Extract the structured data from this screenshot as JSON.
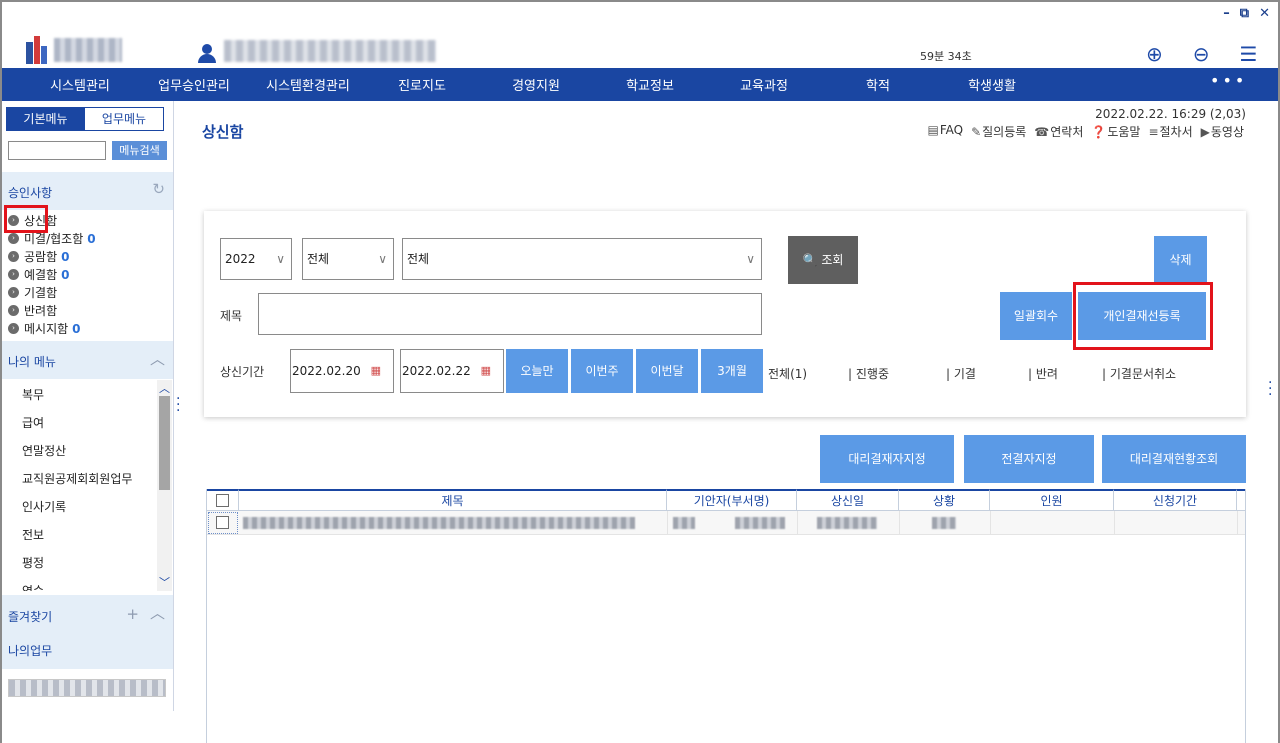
{
  "window": {
    "minimize": "–",
    "restore": "⧉",
    "close": "✕"
  },
  "header": {
    "timer": "59분 34초",
    "icons": [
      "zoom-in-icon",
      "zoom-out-icon",
      "menu-icon"
    ]
  },
  "nav": {
    "items": [
      "시스템관리",
      "업무승인관리",
      "시스템환경관리",
      "진로지도",
      "경영지원",
      "학교정보",
      "교육과정",
      "학적",
      "학생생활"
    ],
    "more": "•••"
  },
  "sidebar": {
    "tabs": [
      "기본메뉴",
      "업무메뉴"
    ],
    "search_button": "메뉴검색",
    "approval_title": "승인사항",
    "approval_items": [
      {
        "label": "상신함",
        "count": ""
      },
      {
        "label": "미결/협조함",
        "count": "0"
      },
      {
        "label": "공람함",
        "count": "0"
      },
      {
        "label": "예결함",
        "count": "0"
      },
      {
        "label": "기결함",
        "count": ""
      },
      {
        "label": "반려함",
        "count": ""
      },
      {
        "label": "메시지함",
        "count": "0"
      }
    ],
    "my_menu_title": "나의 메뉴",
    "my_menu_items": [
      "복무",
      "급여",
      "연말정산",
      "교직원공제회회원업무",
      "인사기록",
      "전보",
      "평정",
      "연수"
    ],
    "favorites_title": "즐겨찾기",
    "my_work_title": "나의업무"
  },
  "main": {
    "title": "상신함",
    "datetime": "2022.02.22. 16:29 (2,03)",
    "links": [
      "FAQ",
      "질의등록",
      "연락처",
      "도움말",
      "절차서",
      "동영상"
    ],
    "year_select": "2022",
    "type_select": "전체",
    "form_select": "전체",
    "search_button": "조회",
    "delete_button": "삭제",
    "subject_label": "제목",
    "bulk_recall_button": "일괄회수",
    "register_button": "개인결재선등록",
    "period_label": "상신기간",
    "date_from": "2022.02.20",
    "date_to": "2022.02.22",
    "period_buttons": [
      "오늘만",
      "이번주",
      "이번달",
      "3개월"
    ],
    "filters": [
      "전체(1)",
      "| 진행중",
      "| 기결",
      "| 반려",
      "| 기결문서취소"
    ],
    "action_buttons": [
      "대리결재자지정",
      "전결자지정",
      "대리결재현황조회"
    ],
    "table_headers": [
      "제목",
      "기안자(부서명)",
      "상신일",
      "상황",
      "인원",
      "신청기간"
    ]
  }
}
